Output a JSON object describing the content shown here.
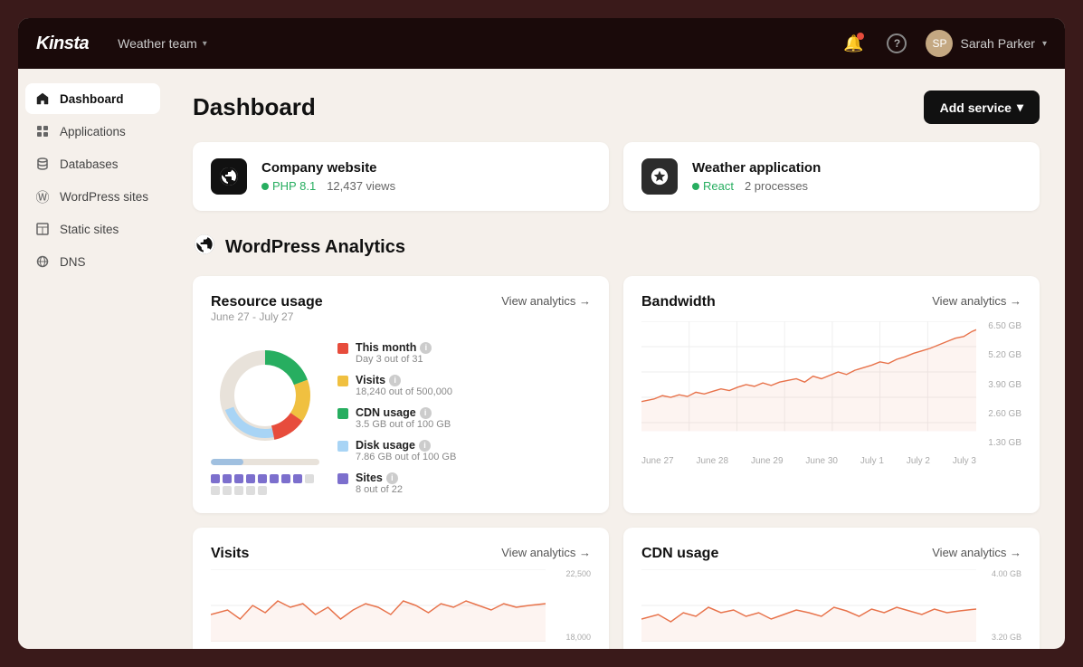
{
  "topnav": {
    "logo": "Kinsta",
    "team": "Weather team",
    "user_name": "Sarah Parker",
    "notifications_icon": "🔔",
    "help_icon": "?",
    "chevron": "▾"
  },
  "sidebar": {
    "items": [
      {
        "id": "dashboard",
        "label": "Dashboard",
        "icon": "⌂",
        "active": true
      },
      {
        "id": "applications",
        "label": "Applications",
        "icon": "◈",
        "active": false
      },
      {
        "id": "databases",
        "label": "Databases",
        "icon": "◎",
        "active": false
      },
      {
        "id": "wordpress-sites",
        "label": "WordPress sites",
        "icon": "Ⓦ",
        "active": false
      },
      {
        "id": "static-sites",
        "label": "Static sites",
        "icon": "⊡",
        "active": false
      },
      {
        "id": "dns",
        "label": "DNS",
        "icon": "⊞",
        "active": false
      }
    ]
  },
  "header": {
    "title": "Dashboard",
    "add_service_label": "Add service",
    "add_service_chevron": "▾"
  },
  "site_cards": [
    {
      "name": "Company website",
      "icon_type": "wp",
      "status_text": "PHP 8.1",
      "meta_text": "12,437 views"
    },
    {
      "name": "Weather application",
      "icon_type": "layers",
      "status_text": "React",
      "meta_text": "2 processes"
    }
  ],
  "wp_analytics": {
    "section_title": "WordPress Analytics"
  },
  "resource_usage": {
    "title": "Resource usage",
    "subtitle": "June 27 - July 27",
    "view_link": "View analytics →",
    "legend": [
      {
        "label": "This month",
        "sub": "Day 3 out of 31",
        "color": "#e74c3c"
      },
      {
        "label": "Visits",
        "sub": "18,240 out of 500,000",
        "color": "#f0c040"
      },
      {
        "label": "CDN usage",
        "sub": "3.5 GB out of 100 GB",
        "color": "#27ae60"
      },
      {
        "label": "Disk usage",
        "sub": "7.86 GB out of 100 GB",
        "color": "#a8d4f5"
      },
      {
        "label": "Sites",
        "sub": "8 out of 22",
        "color": "#7c6fcd"
      }
    ]
  },
  "bandwidth": {
    "title": "Bandwidth",
    "view_link": "View analytics →",
    "y_labels": [
      "6.50 GB",
      "5.20 GB",
      "3.90 GB",
      "2.60 GB",
      "1.30 GB"
    ],
    "x_labels": [
      "June 27",
      "June 28",
      "June 29",
      "June 30",
      "July 1",
      "July 2",
      "July 3"
    ]
  },
  "visits_card": {
    "title": "Visits",
    "view_link": "View analytics →",
    "y_labels": [
      "22,500",
      "18,000"
    ]
  },
  "cdn_card": {
    "title": "CDN usage",
    "view_link": "View analytics →",
    "y_labels": [
      "4.00 GB",
      "3.20 GB"
    ]
  }
}
